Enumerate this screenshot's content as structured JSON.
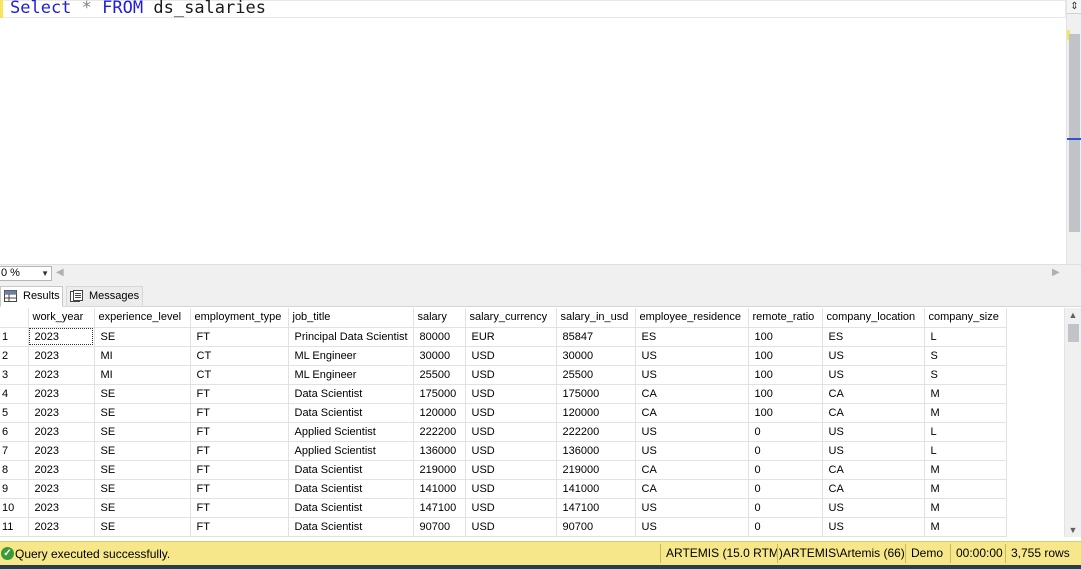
{
  "editor": {
    "query_select": "Select",
    "query_star": "*",
    "query_from": "FROM",
    "query_table": "ds_salaries"
  },
  "zoom": {
    "value": "0 %"
  },
  "tabs": [
    {
      "label": "Results",
      "icon": "grid-icon",
      "active": true
    },
    {
      "label": "Messages",
      "icon": "messages-icon",
      "active": false
    }
  ],
  "grid": {
    "columns": [
      "work_year",
      "experience_level",
      "employment_type",
      "job_title",
      "salary",
      "salary_currency",
      "salary_in_usd",
      "employee_residence",
      "remote_ratio",
      "company_location",
      "company_size"
    ],
    "rows": [
      [
        "1",
        "2023",
        "SE",
        "FT",
        "Principal Data Scientist",
        "80000",
        "EUR",
        "85847",
        "ES",
        "100",
        "ES",
        "L"
      ],
      [
        "2",
        "2023",
        "MI",
        "CT",
        "ML Engineer",
        "30000",
        "USD",
        "30000",
        "US",
        "100",
        "US",
        "S"
      ],
      [
        "3",
        "2023",
        "MI",
        "CT",
        "ML Engineer",
        "25500",
        "USD",
        "25500",
        "US",
        "100",
        "US",
        "S"
      ],
      [
        "4",
        "2023",
        "SE",
        "FT",
        "Data Scientist",
        "175000",
        "USD",
        "175000",
        "CA",
        "100",
        "CA",
        "M"
      ],
      [
        "5",
        "2023",
        "SE",
        "FT",
        "Data Scientist",
        "120000",
        "USD",
        "120000",
        "CA",
        "100",
        "CA",
        "M"
      ],
      [
        "6",
        "2023",
        "SE",
        "FT",
        "Applied Scientist",
        "222200",
        "USD",
        "222200",
        "US",
        "0",
        "US",
        "L"
      ],
      [
        "7",
        "2023",
        "SE",
        "FT",
        "Applied Scientist",
        "136000",
        "USD",
        "136000",
        "US",
        "0",
        "US",
        "L"
      ],
      [
        "8",
        "2023",
        "SE",
        "FT",
        "Data Scientist",
        "219000",
        "USD",
        "219000",
        "CA",
        "0",
        "CA",
        "M"
      ],
      [
        "9",
        "2023",
        "SE",
        "FT",
        "Data Scientist",
        "141000",
        "USD",
        "141000",
        "CA",
        "0",
        "CA",
        "M"
      ],
      [
        "10",
        "2023",
        "SE",
        "FT",
        "Data Scientist",
        "147100",
        "USD",
        "147100",
        "US",
        "0",
        "US",
        "M"
      ],
      [
        "11",
        "2023",
        "SE",
        "FT",
        "Data Scientist",
        "90700",
        "USD",
        "90700",
        "US",
        "0",
        "US",
        "M"
      ]
    ]
  },
  "status": {
    "message": "Query executed successfully.",
    "server": "ARTEMIS (15.0 RTM)",
    "user": "ARTEMIS\\Artemis (66)",
    "database": "Demo",
    "elapsed": "00:00:00",
    "rows": "3,755 rows",
    "color": "#f6e88a"
  }
}
